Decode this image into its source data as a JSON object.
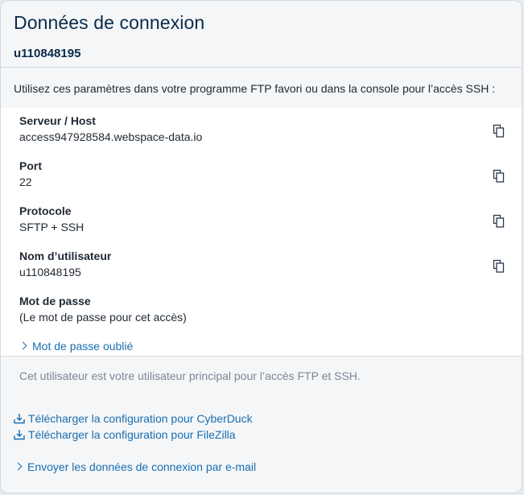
{
  "dialog": {
    "title": "Données de connexion",
    "username_header": "u110848195"
  },
  "intro": "Utilisez ces paramètres dans votre programme FTP favori ou dans la console pour l’accès SSH :",
  "fields": [
    {
      "label": "Serveur / Host",
      "value": "access947928584.webspace-data.io",
      "copy_icon": "copy-icon"
    },
    {
      "label": "Port",
      "value": "22",
      "copy_icon": "copy-icon"
    },
    {
      "label": "Protocole",
      "value": "SFTP + SSH",
      "copy_icon": "copy-icon"
    },
    {
      "label": "Nom d’utilisateur",
      "value": "u110848195",
      "copy_icon": "copy-icon"
    }
  ],
  "password": {
    "label": "Mot de passe",
    "value": "(Le mot de passe pour cet accès)",
    "forgot_link": "Mot de passe oublié"
  },
  "note": "Cet utilisateur est votre utilisateur principal pour l’accès FTP et SSH.",
  "downloads": [
    {
      "label": "Télécharger la configuration pour CyberDuck",
      "icon": "download-icon"
    },
    {
      "label": "Télécharger la configuration pour FileZilla",
      "icon": "download-icon"
    }
  ],
  "email_link": "Envoyer les données de connexion par e-mail",
  "colors": {
    "link": "#1a6fb1",
    "title": "#0b2a4a",
    "muted": "#7b8794"
  }
}
